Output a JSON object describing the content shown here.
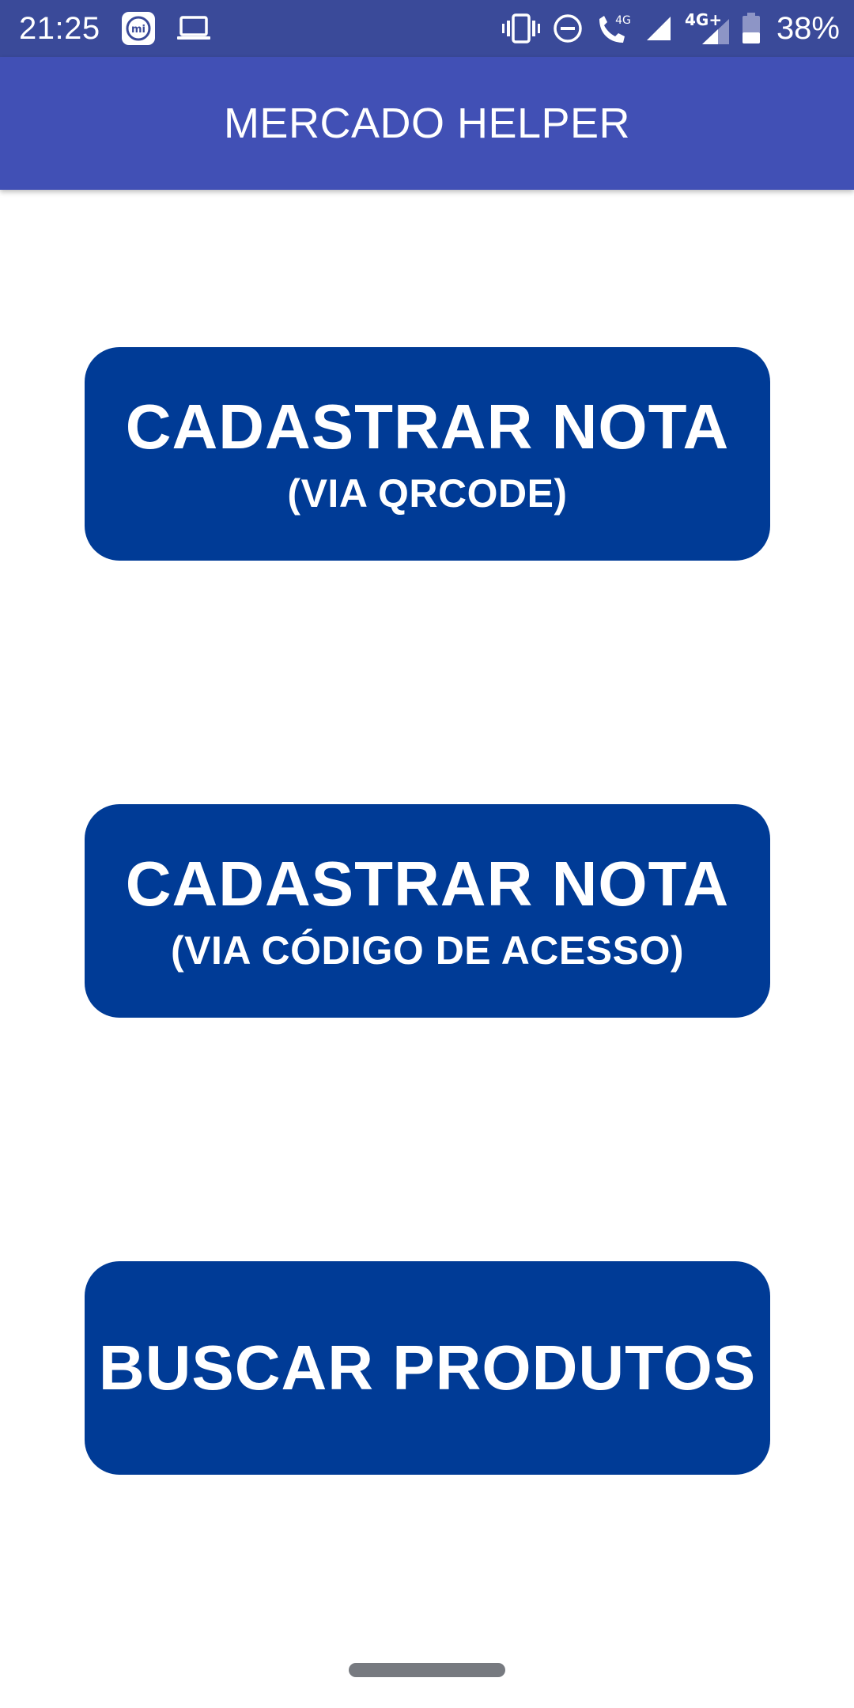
{
  "status_bar": {
    "time": "21:25",
    "left_icons": [
      "mi-icon",
      "laptop-icon"
    ],
    "right_icons": [
      "vibrate-icon",
      "do-not-disturb-icon",
      "volte-call-icon",
      "signal-icon",
      "signal-icon"
    ],
    "call_network_label": "4G",
    "network_label": "4G+",
    "battery_percent": "38%",
    "battery_level": 0.38
  },
  "app_bar": {
    "title": "MERCADO HELPER",
    "color": "#4150b5"
  },
  "buttons": {
    "qrcode": {
      "title": "CADASTRAR NOTA",
      "subtitle": "(VIA QRCODE)"
    },
    "access_code": {
      "title": "CADASTRAR NOTA",
      "subtitle": "(VIA CÓDIGO DE ACESSO)"
    },
    "search": {
      "title": "BUSCAR PRODUTOS"
    },
    "color": "#003b96"
  }
}
